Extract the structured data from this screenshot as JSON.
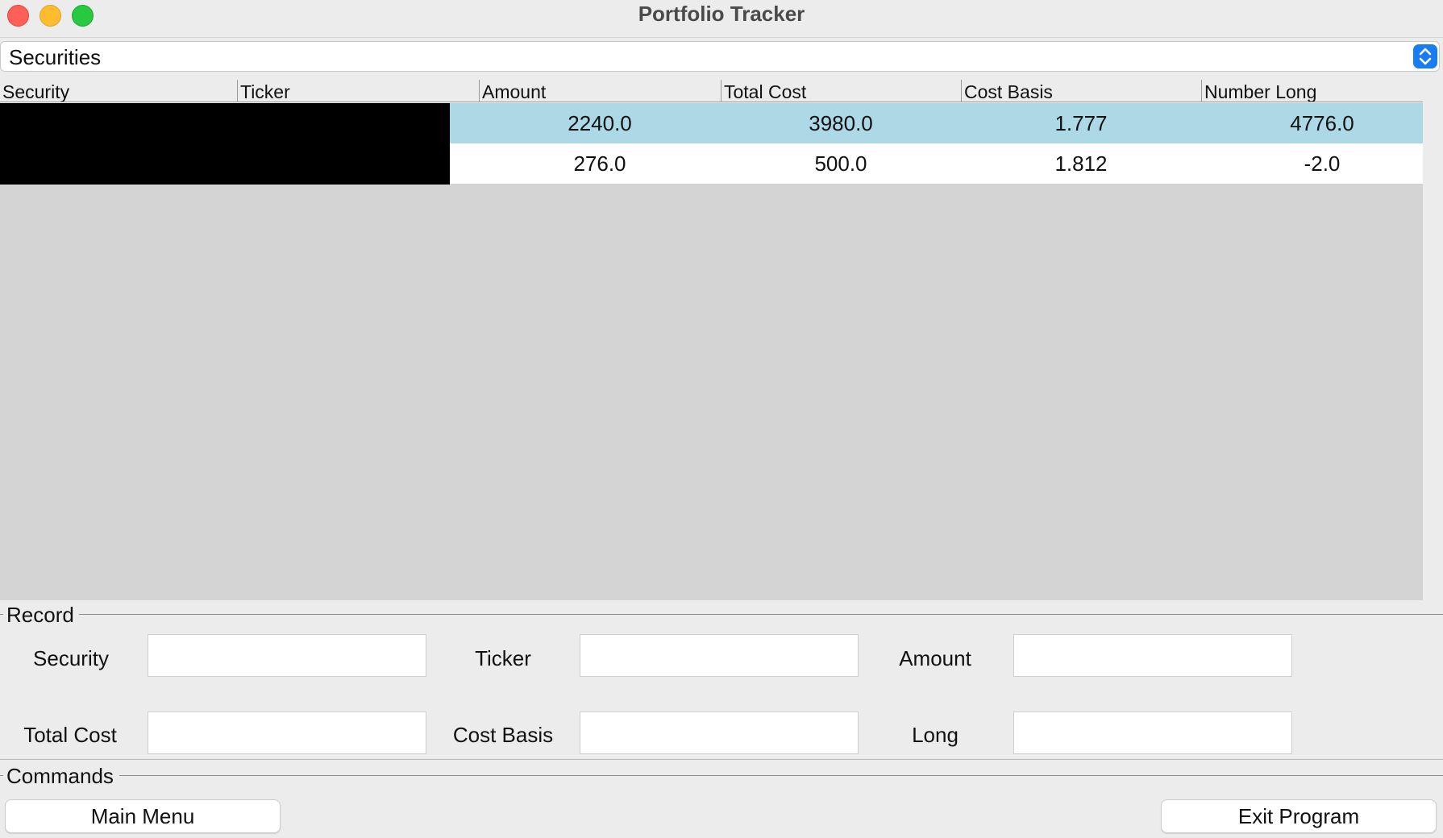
{
  "window": {
    "title": "Portfolio Tracker"
  },
  "selector": {
    "value": "Securities"
  },
  "table": {
    "columns": [
      "Security",
      "Ticker",
      "Amount",
      "Total Cost",
      "Cost Basis",
      "Number Long"
    ],
    "rows": [
      {
        "security": "",
        "ticker": "",
        "amount": "2240.0",
        "total_cost": "3980.0",
        "cost_basis": "1.777",
        "number_long": "4776.0",
        "selected": true
      },
      {
        "security": "",
        "ticker": "",
        "amount": "276.0",
        "total_cost": "500.0",
        "cost_basis": "1.812",
        "number_long": "-2.0",
        "selected": false
      }
    ]
  },
  "record": {
    "title": "Record",
    "labels": {
      "security": "Security",
      "ticker": "Ticker",
      "amount": "Amount",
      "total_cost": "Total Cost",
      "cost_basis": "Cost Basis",
      "long": "Long"
    },
    "values": {
      "security": "",
      "ticker": "",
      "amount": "",
      "total_cost": "",
      "cost_basis": "",
      "long": ""
    }
  },
  "commands": {
    "title": "Commands",
    "main_menu": "Main Menu",
    "exit_program": "Exit Program"
  },
  "colors": {
    "selected_row": "#add8e6",
    "accent": "#1a7cf5"
  }
}
